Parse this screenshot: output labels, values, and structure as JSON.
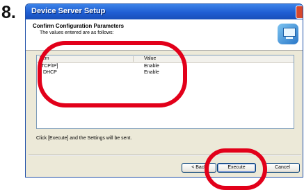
{
  "step": "8.",
  "window": {
    "title": "Device Server Setup"
  },
  "header": {
    "title": "Confirm Configuration Parameters",
    "subtitle": "The values entered are as follows:",
    "icon": "computer-monitor-icon"
  },
  "table": {
    "columns": [
      "Item",
      "Value"
    ],
    "rows": [
      {
        "item": "[TCP/IP]",
        "value": "Enable"
      },
      {
        "item": "DHCP",
        "value": "Enable"
      }
    ]
  },
  "footer_note": "Click [Execute] and the Settings will be sent.",
  "buttons": {
    "back": "< Back",
    "execute": "Execute",
    "cancel": "Cancel"
  },
  "colors": {
    "annotation": "#e2001a",
    "titlebar": "#1f5ed3"
  }
}
